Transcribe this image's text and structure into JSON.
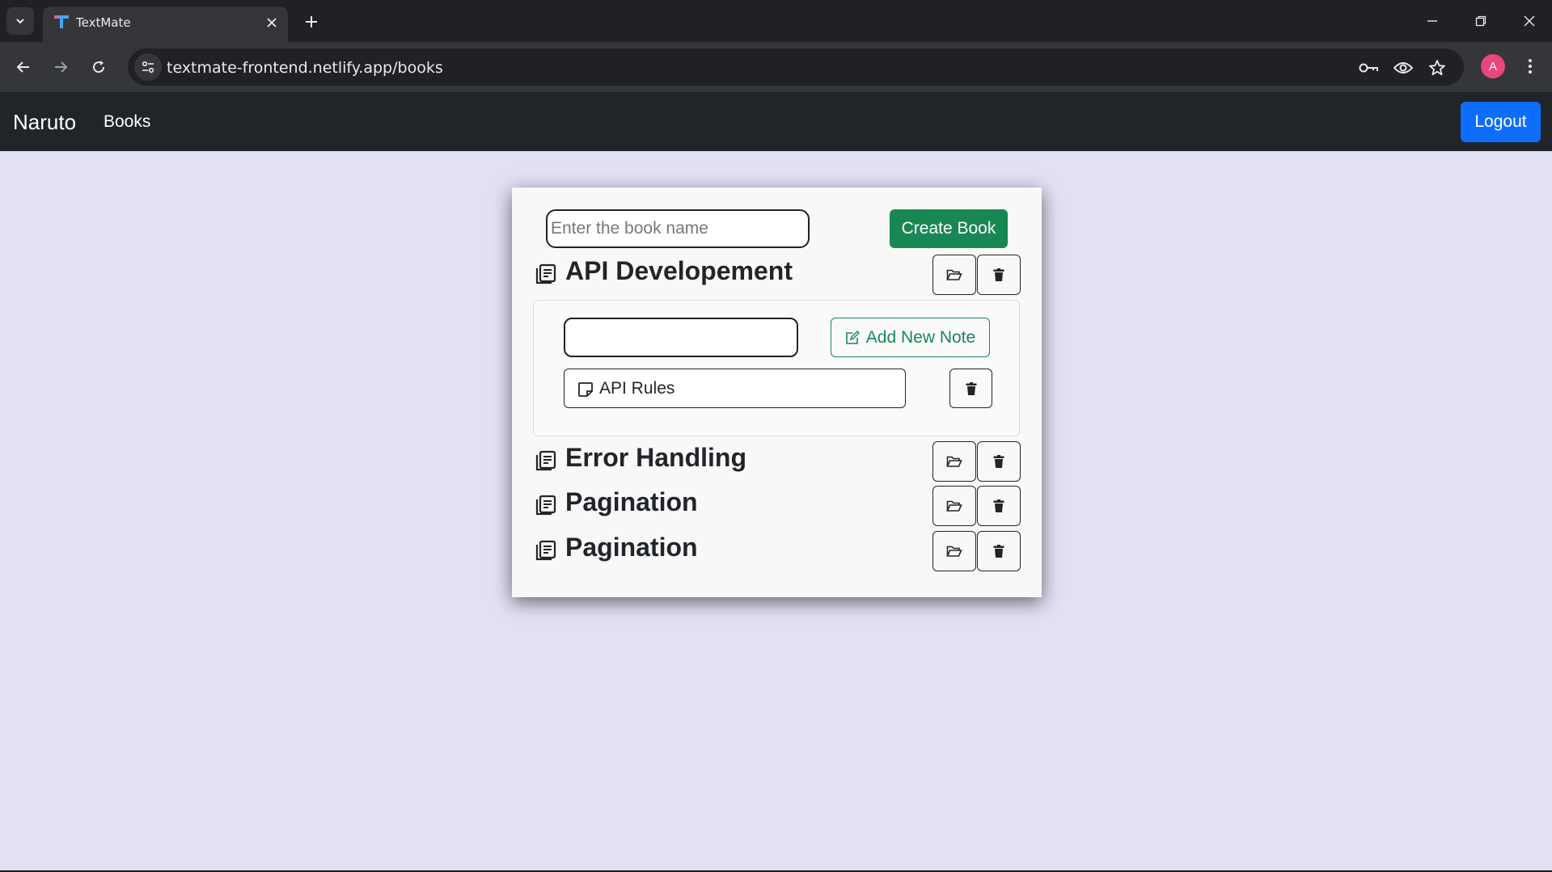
{
  "browser": {
    "tab_title": "TextMate",
    "url": "textmate-frontend.netlify.app/books",
    "profile_initial": "A"
  },
  "navbar": {
    "brand": "Naruto",
    "link": "Books",
    "logout_label": "Logout"
  },
  "create": {
    "placeholder": "Enter the book name",
    "button_label": "Create Book"
  },
  "books": [
    {
      "title": "API Developement",
      "expanded": true,
      "notes_panel": {
        "input_value": "",
        "add_label": "Add New Note",
        "notes": [
          {
            "title": "API Rules"
          }
        ]
      }
    },
    {
      "title": "Error Handling"
    },
    {
      "title": "Pagination"
    },
    {
      "title": "Pagination"
    }
  ],
  "colors": {
    "page_bg": "#e2e0f3",
    "navbar_bg": "#212529",
    "primary": "#0d6efd",
    "success": "#198754"
  }
}
